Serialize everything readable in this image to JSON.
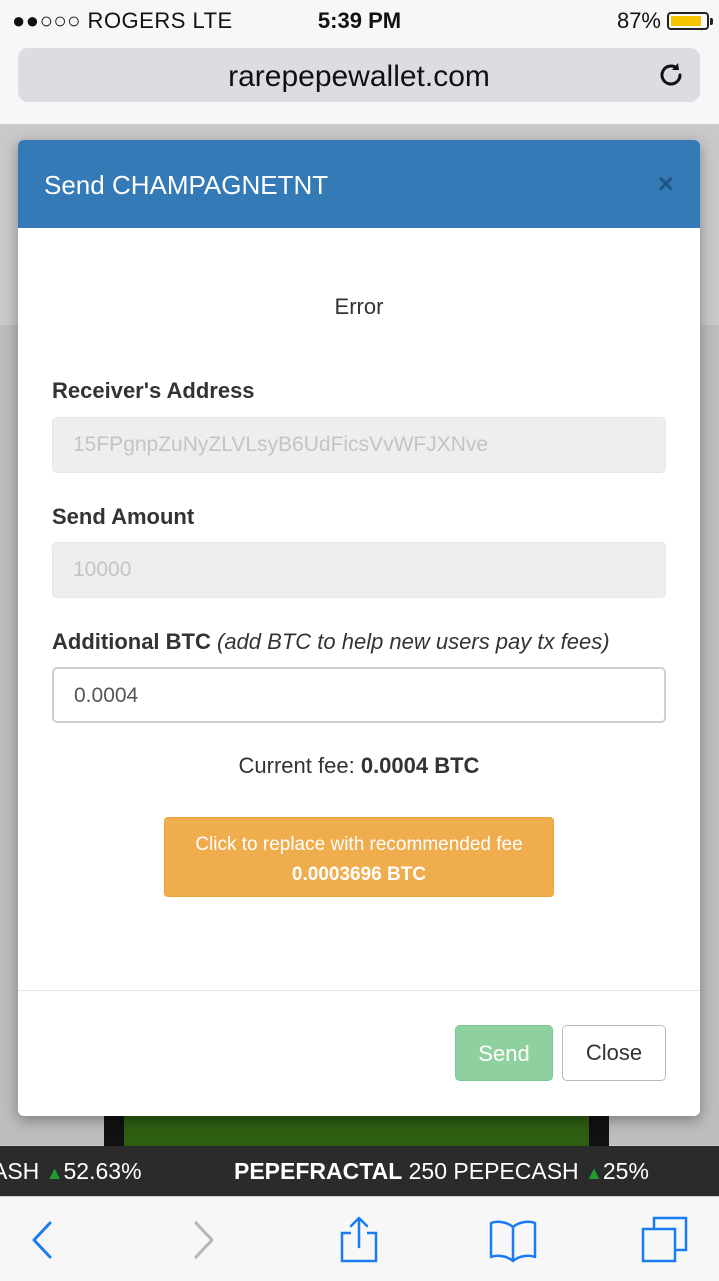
{
  "status_bar": {
    "carrier": "●●○○○ ROGERS  LTE",
    "time": "5:39 PM",
    "battery": "87%",
    "battery_level": 0.87
  },
  "browser": {
    "url": "rarepepewallet.com"
  },
  "modal": {
    "title": "Send CHAMPAGNETNT",
    "close_symbol": "×",
    "error": "Error",
    "receiver_label": "Receiver's Address",
    "receiver_value": "15FPgnpZuNyZLVLsyB6UdFicsVvWFJXNve",
    "amount_label": "Send Amount",
    "amount_value": "10000",
    "additional_label": "Additional BTC",
    "additional_hint": "(add BTC to help new users pay tx fees)",
    "additional_value": "0.0004",
    "current_fee_label": "Current fee:",
    "current_fee_value": "0.0004 BTC",
    "recommend_line1": "Click to replace with recommended fee",
    "recommend_line2": "0.0003696 BTC",
    "send_button": "Send",
    "close_button": "Close"
  },
  "ticker": {
    "left_text": "ASH",
    "left_change": "52.63%",
    "right_name": "PEPEFRACTAL",
    "right_price": "250 PEPECASH",
    "right_change": "25%"
  },
  "icons": [
    "reload-icon",
    "back-icon",
    "forward-icon",
    "share-icon",
    "bookmarks-icon",
    "tabs-icon"
  ]
}
